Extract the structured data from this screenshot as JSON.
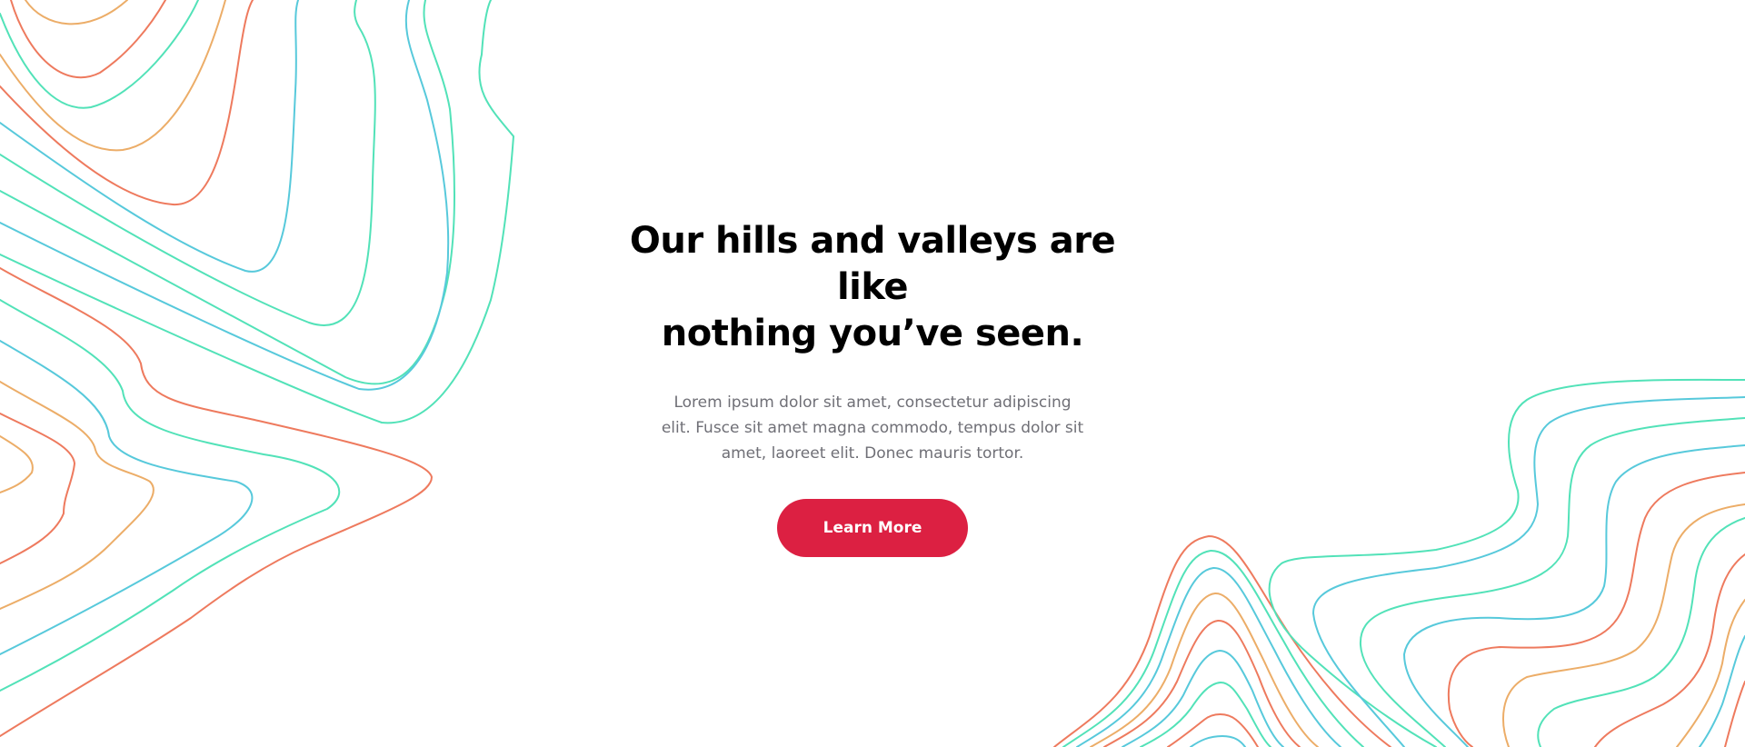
{
  "hero": {
    "title_line_1": "Our hills and valleys are like",
    "title_line_2": "nothing you’ve seen.",
    "body_text": "Lorem ipsum dolor sit amet, consectetur adipiscing elit. Fusce sit amet magna commodo, tempus dolor sit amet, laoreet elit. Donec mauris tortor.",
    "cta_label": "Learn More"
  },
  "colors": {
    "background": "#ffffff",
    "title": "#000000",
    "body_text": "#6f6f76",
    "cta_background": "#dc2042",
    "cta_text": "#ffffff",
    "contour_coral": "#ee7a5e",
    "contour_orange": "#ecad68",
    "contour_cyan": "#57c9db",
    "contour_teal": "#52e2b8"
  },
  "decorations": {
    "left": "topographic-contour-lines",
    "right": "topographic-contour-lines"
  }
}
